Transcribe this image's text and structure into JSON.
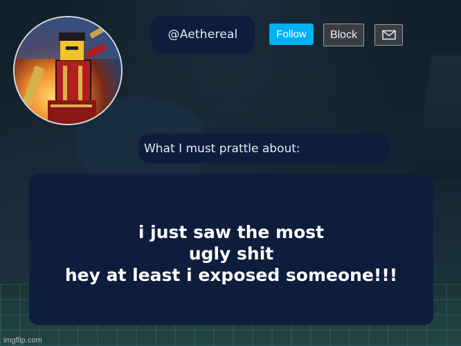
{
  "profile": {
    "username": "@Aethereal",
    "avatar_icon": "avatar-icon"
  },
  "actions": {
    "follow_label": "Follow",
    "block_label": "Block",
    "message_icon": "envelope-icon"
  },
  "prompt": {
    "label": "What I must prattle about:"
  },
  "post": {
    "lines": [
      "i just saw the most",
      "ugly shit",
      "hey at least i exposed someone!!!"
    ]
  },
  "watermark": "imgflip.com",
  "colors": {
    "pill_bg": "#0f1d3d",
    "follow_bg": "#00b0f4",
    "block_bg": "#3a3d43"
  }
}
